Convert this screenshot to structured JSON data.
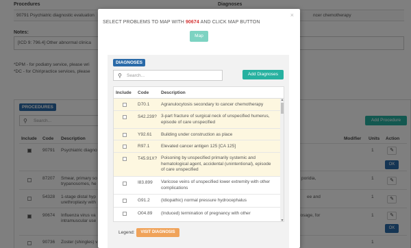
{
  "background": {
    "top_table": {
      "headers": [
        "Procedures",
        "Diagnoses"
      ],
      "row": {
        "procedure": "90791 Psychiatric diagnostic evaluation",
        "diagnosis": "ncer chemotherapy"
      }
    },
    "notes": {
      "label": "Notes:",
      "value": "[ICD 9: 796.4] Other abnormal clinica"
    },
    "footnotes": [
      "*DPM - for podiatry service, please wri",
      "*DC - for Chiripractice services, please"
    ],
    "procedures": {
      "badge": "PROCEDURES",
      "search_placeholder": "Search...",
      "add_button": "Add Procedure",
      "headers": {
        "include": "Include",
        "code": "Code",
        "description": "Description",
        "modifier": "Modifier",
        "units": "Units",
        "action": "Action"
      },
      "ok_label": "OK",
      "rows": [
        {
          "checked": true,
          "code": "90791",
          "desc_lines": [
            "Psychiatric diagno"
          ],
          "right_lines": [],
          "units": "1"
        },
        {
          "checked": false,
          "code": "87207",
          "desc_lines": [
            "Smear, primary so",
            "trypanosomes, he"
          ],
          "right_lines": [
            "poridia,"
          ],
          "units": "1"
        },
        {
          "checked": false,
          "code": "54328",
          "desc_lines": [
            "1-stage distal hyp",
            "urethroplasty with"
          ],
          "right_lines": [
            "ee and"
          ],
          "units": "1"
        },
        {
          "checked": true,
          "code": "90674",
          "desc_lines": [
            "Influenza virus va",
            "intramuscular use"
          ],
          "right_lines": [
            "on, dosage, for"
          ],
          "units": "1"
        },
        {
          "checked": false,
          "code": "90736",
          "desc_lines": [
            "Zoster (shingles) v"
          ],
          "right_lines": [],
          "units": "1"
        }
      ]
    }
  },
  "modal": {
    "title_prefix": "SELECT PROBLEMS TO MAP WITH",
    "procedure_code": "90674",
    "title_suffix": "AND CLICK MAP BUTTON",
    "close": "×",
    "map_button": "Map",
    "diagnoses_badge": "DIAGNOSES",
    "search_placeholder": "Search...",
    "add_button": "Add Diagnoses",
    "headers": {
      "include": "Include",
      "code": "Code",
      "description": "Description"
    },
    "rows": [
      {
        "code": "D70.1",
        "highlight": true,
        "lines": [
          "Agranulocytosis secondary to cancer chemotherapy"
        ]
      },
      {
        "code": "S42.239?",
        "highlight": true,
        "lines": [
          "3-part fracture of surgical neck of unspecified humerus,",
          "episode of care unspecified"
        ]
      },
      {
        "code": "Y92.61",
        "highlight": true,
        "lines": [
          "Building under construction as place"
        ]
      },
      {
        "code": "R97.1",
        "highlight": true,
        "lines": [
          "Elevated cancer antigen 125 [CA 125]"
        ]
      },
      {
        "code": "T45.91X?",
        "highlight": true,
        "lines": [
          "Poisoning by unspecified primarily systemic and",
          "hematological agent, accidental (unintentional), episode",
          "of care unspecified"
        ]
      },
      {
        "code": "I83.899",
        "highlight": false,
        "lines": [
          "Varicose veins of unspecified lower extremity with other",
          "complications"
        ]
      },
      {
        "code": "G91.2",
        "highlight": false,
        "lines": [
          "(Idiopathic) normal pressure hydrocephalus"
        ]
      },
      {
        "code": "O04.89",
        "highlight": false,
        "lines": [
          "(Induced) termination of pregnancy with other"
        ]
      }
    ],
    "legend_label": "Legend:",
    "legend_badge": "VISIT DIAGNOSIS",
    "colors": {
      "accent_blue": "#2a6aa8",
      "teal": "#27b1a0",
      "highlight_row": "#fdf7e0",
      "legend": "#f0a35a",
      "code_red": "#d32f2f"
    }
  }
}
